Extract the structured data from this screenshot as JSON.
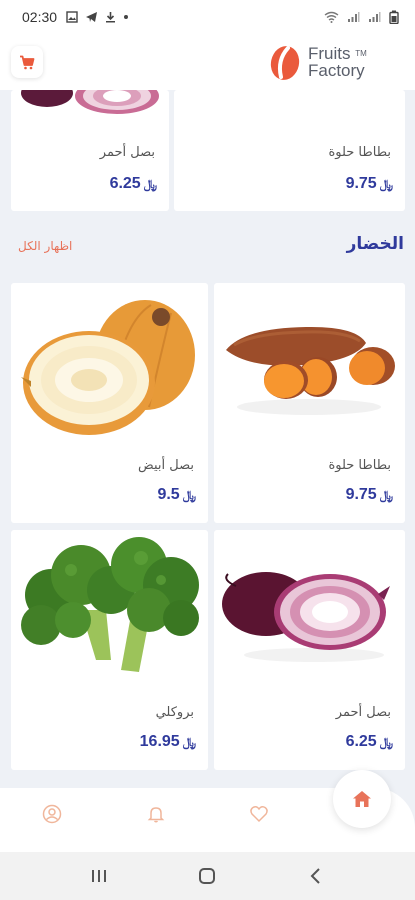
{
  "status_bar": {
    "time": "02:30",
    "left_icons": [
      "image-icon",
      "telegram-icon",
      "download-icon",
      "dot-icon"
    ],
    "right_icons": [
      "wifi-icon",
      "signal-icon",
      "signal-icon",
      "battery-icon"
    ]
  },
  "header": {
    "logo_line1": "Fruits",
    "logo_line2": "Factory",
    "logo_tm": "TM",
    "brand_color": "#ea5a3c",
    "cart_icon": "cart-icon"
  },
  "top_row": [
    {
      "name": "بطاطا حلوة",
      "price": "9.75",
      "currency": "﷼"
    },
    {
      "name": "بصل أحمر",
      "price": "6.25",
      "currency": "﷼"
    }
  ],
  "section": {
    "title": "الخضار",
    "show_all": "اظهار الكل"
  },
  "vegetables": [
    {
      "name": "بطاطا حلوة",
      "price": "9.75",
      "currency": "﷼",
      "image": "sweet-potato"
    },
    {
      "name": "بصل أبيض",
      "price": "9.5",
      "currency": "﷼",
      "image": "white-onion"
    },
    {
      "name": "بصل أحمر",
      "price": "6.25",
      "currency": "﷼",
      "image": "red-onion"
    },
    {
      "name": "بروكلي",
      "price": "16.95",
      "currency": "﷼",
      "image": "broccoli"
    }
  ],
  "bottom_nav": {
    "items": [
      "profile-icon",
      "bell-icon",
      "heart-icon",
      "home-icon"
    ],
    "accent": "#e8735a",
    "muted": "#f0b69b"
  },
  "system_nav": [
    "recents-icon",
    "home-circle-icon",
    "back-icon"
  ]
}
